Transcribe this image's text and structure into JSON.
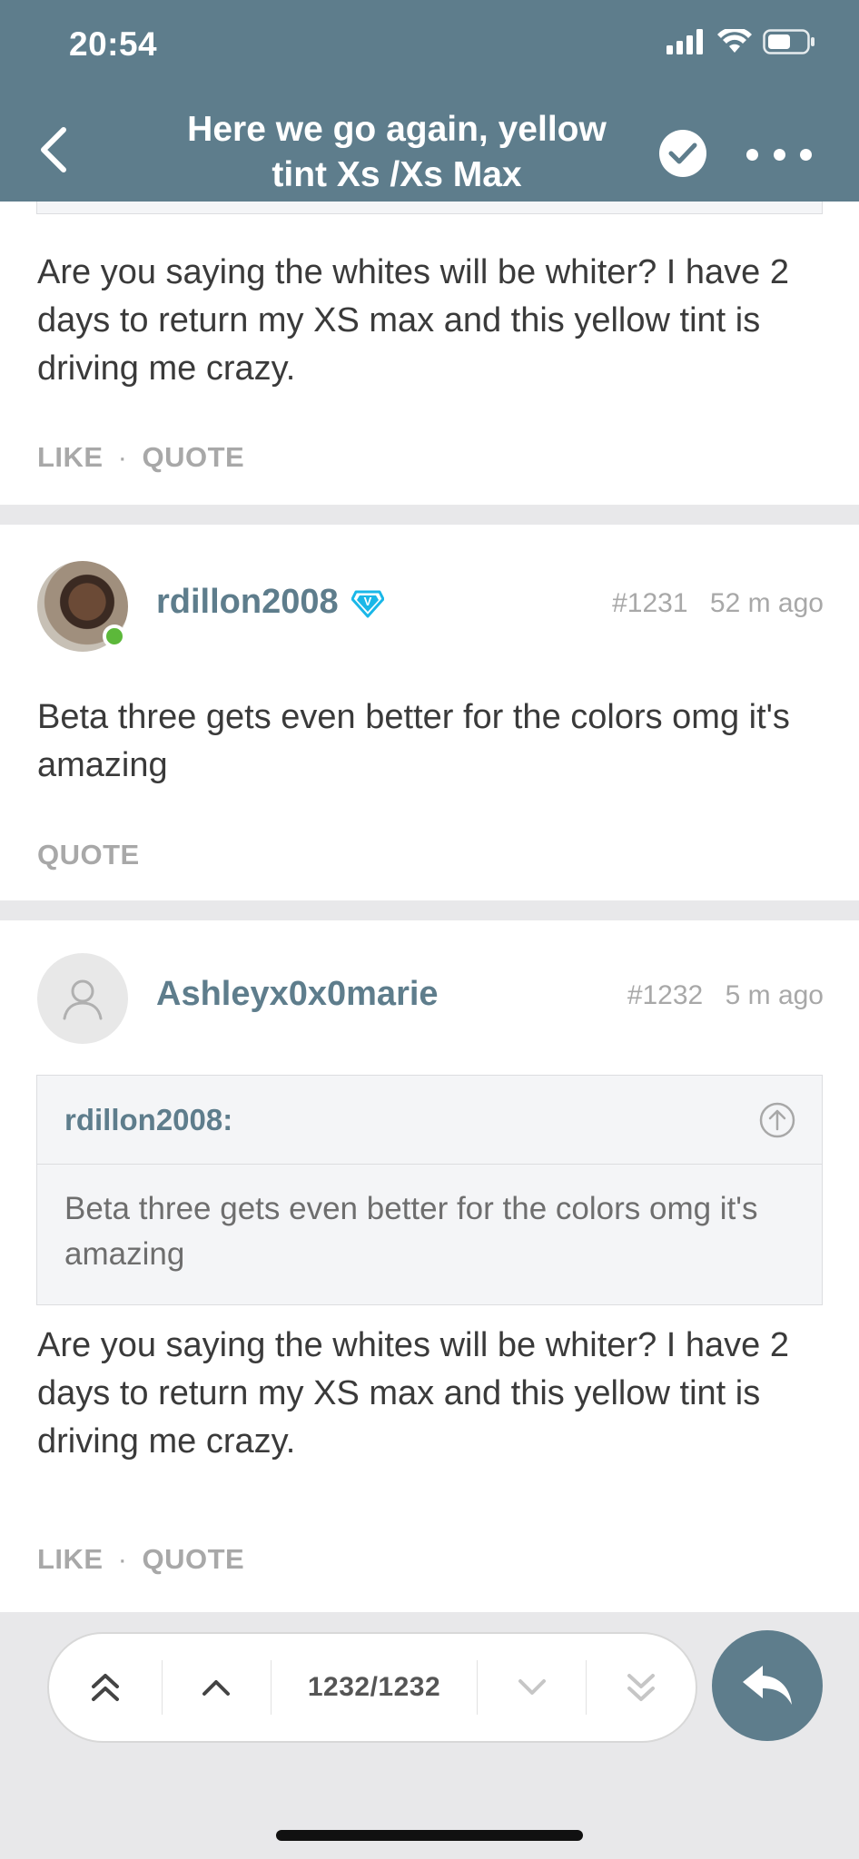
{
  "status_bar": {
    "time": "20:54"
  },
  "header": {
    "title_line1": "Here we go again, yellow",
    "title_line2": "tint Xs /Xs Max",
    "accent_color": "#5e7d8c"
  },
  "posts": [
    {
      "text": "Are you saying the whites will be whiter? I have 2 days to return my XS max and this yellow tint is driving me crazy.",
      "actions": {
        "like": "LIKE",
        "separator": "·",
        "quote": "QUOTE"
      }
    },
    {
      "username": "rdillon2008",
      "verified_badge": "V",
      "post_number": "#1231",
      "time_ago": "52 m ago",
      "text": "Beta three gets even better for the colors omg it's amazing",
      "actions": {
        "quote": "QUOTE"
      }
    },
    {
      "username": "Ashleyx0x0marie",
      "post_number": "#1232",
      "time_ago": "5 m ago",
      "quote": {
        "author": "rdillon2008:",
        "text": "Beta three gets even better for the colors omg it's amazing"
      },
      "text": "Are you saying the whites will be whiter? I have 2 days to return my XS max and this yellow tint is driving me crazy.",
      "actions": {
        "like": "LIKE",
        "separator": "·",
        "quote": "QUOTE"
      }
    }
  ],
  "pager": {
    "position": "1232/1232"
  },
  "icons": [
    "back-icon",
    "checkmark-icon",
    "more-icon",
    "user-placeholder-icon",
    "verified-icon",
    "jump-to-quote-icon",
    "first-page-icon",
    "previous-icon",
    "next-icon",
    "last-page-icon",
    "reply-icon"
  ]
}
